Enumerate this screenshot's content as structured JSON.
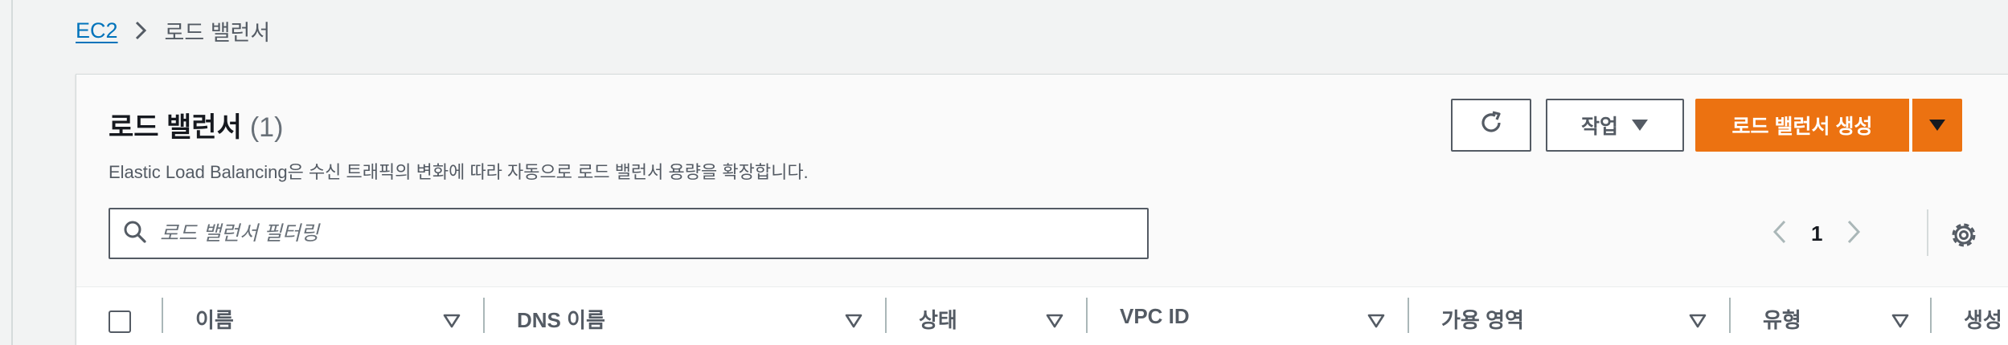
{
  "breadcrumb": {
    "root": "EC2",
    "current": "로드 밸런서"
  },
  "panel": {
    "title": "로드 밸런서",
    "count": "(1)",
    "description": "Elastic Load Balancing은 수신 트래픽의 변화에 따라 자동으로 로드 밸런서 용량을 확장합니다."
  },
  "toolbar": {
    "refresh_icon": "refresh-icon",
    "actions_label": "작업",
    "create_label": "로드 밸런서 생성"
  },
  "search": {
    "placeholder": "로드 밸런서 필터링"
  },
  "pagination": {
    "current_page": "1"
  },
  "table": {
    "columns": [
      {
        "label": "이름"
      },
      {
        "label": "DNS 이름"
      },
      {
        "label": "상태"
      },
      {
        "label": "VPC ID"
      },
      {
        "label": "가용 영역"
      },
      {
        "label": "유형"
      },
      {
        "label": "생성"
      }
    ]
  },
  "colors": {
    "link": "#0073bb",
    "primary": "#ec7211",
    "border": "#545b64",
    "background": "#f2f3f3"
  }
}
